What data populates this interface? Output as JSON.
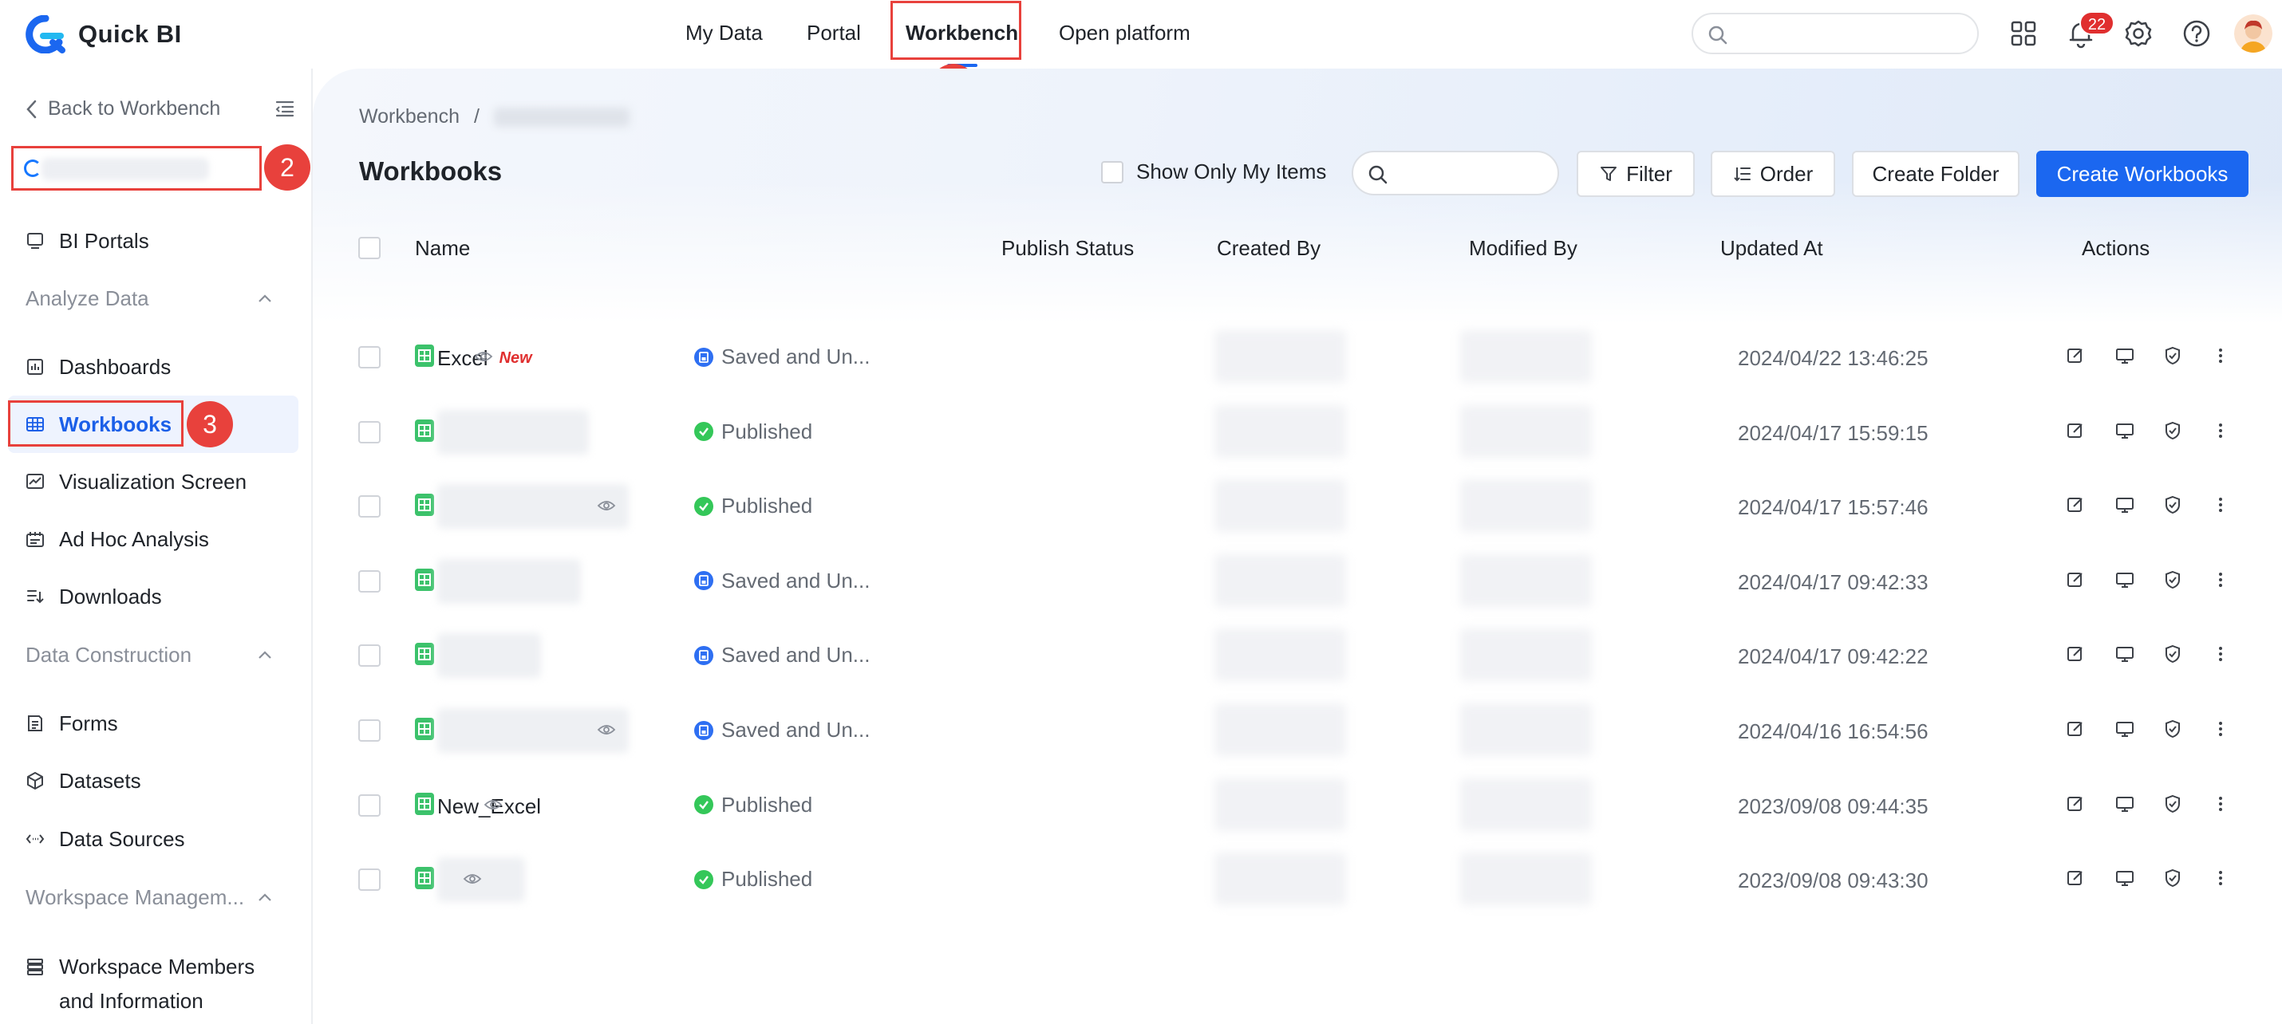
{
  "app": {
    "name": "Quick BI",
    "brand_color": "#1b67f0",
    "annotation_color": "#e8413c"
  },
  "top_nav": {
    "items": [
      {
        "label": "My Data",
        "active": false
      },
      {
        "label": "Portal",
        "active": false
      },
      {
        "label": "Workbench",
        "active": true
      },
      {
        "label": "Open platform",
        "active": false
      }
    ],
    "search_placeholder": "",
    "notification_count": "22",
    "icons": [
      "apps-grid-icon",
      "bell-icon",
      "gear-icon",
      "help-icon",
      "user-avatar"
    ]
  },
  "annotations": [
    "1",
    "2",
    "3"
  ],
  "sidebar": {
    "back_label": "Back to Workbench",
    "items": [
      {
        "label": "BI Portals",
        "icon": "monitor-icon"
      },
      {
        "label": "Analyze Data",
        "group": true
      },
      {
        "label": "Dashboards",
        "icon": "bar-chart-icon"
      },
      {
        "label": "Workbooks",
        "icon": "table-icon",
        "active": true
      },
      {
        "label": "Visualization Screen",
        "icon": "line-chart-icon"
      },
      {
        "label": "Ad Hoc Analysis",
        "icon": "adhoc-icon"
      },
      {
        "label": "Downloads",
        "icon": "download-list-icon"
      },
      {
        "label": "Data Construction",
        "group": true
      },
      {
        "label": "Forms",
        "icon": "form-icon"
      },
      {
        "label": "Datasets",
        "icon": "cube-icon"
      },
      {
        "label": "Data Sources",
        "icon": "link-icon"
      },
      {
        "label": "Workspace Managem...",
        "group": true
      }
    ],
    "last_item": {
      "line1": "Workspace Members",
      "line2": "and Information"
    }
  },
  "main": {
    "breadcrumb_root": "Workbench",
    "breadcrumb_sep": "/",
    "title": "Workbooks",
    "show_only_mine": "Show Only My Items",
    "buttons": {
      "filter": "Filter",
      "order": "Order",
      "create_folder": "Create Folder",
      "create_workbooks": "Create Workbooks"
    },
    "columns": [
      "Name",
      "Publish Status",
      "Created By",
      "Modified By",
      "Updated At",
      "Actions"
    ],
    "rows": [
      {
        "name": "Excel",
        "tag": "New",
        "status": "Saved and Un...",
        "status_type": "saved",
        "updated": "2024/04/22 13:46:25",
        "eye": true
      },
      {
        "name": "",
        "status": "Published",
        "status_type": "published",
        "updated": "2024/04/17 15:59:15",
        "eye": false
      },
      {
        "name": "",
        "status": "Published",
        "status_type": "published",
        "updated": "2024/04/17 15:57:46",
        "eye": true
      },
      {
        "name": "",
        "status": "Saved and Un...",
        "status_type": "saved",
        "updated": "2024/04/17 09:42:33",
        "eye": false
      },
      {
        "name": "",
        "status": "Saved and Un...",
        "status_type": "saved",
        "updated": "2024/04/17 09:42:22",
        "eye": false
      },
      {
        "name": "",
        "status": "Saved and Un...",
        "status_type": "saved",
        "updated": "2024/04/16 16:54:56",
        "eye": true
      },
      {
        "name": "New_Excel",
        "status": "Published",
        "status_type": "published",
        "updated": "2023/09/08 09:44:35",
        "eye": true
      },
      {
        "name": "",
        "status": "Published",
        "status_type": "published",
        "updated": "2023/09/08 09:43:30",
        "eye": true
      }
    ],
    "row_actions": [
      "edit-icon",
      "present-icon",
      "shield-icon",
      "more-icon"
    ]
  }
}
